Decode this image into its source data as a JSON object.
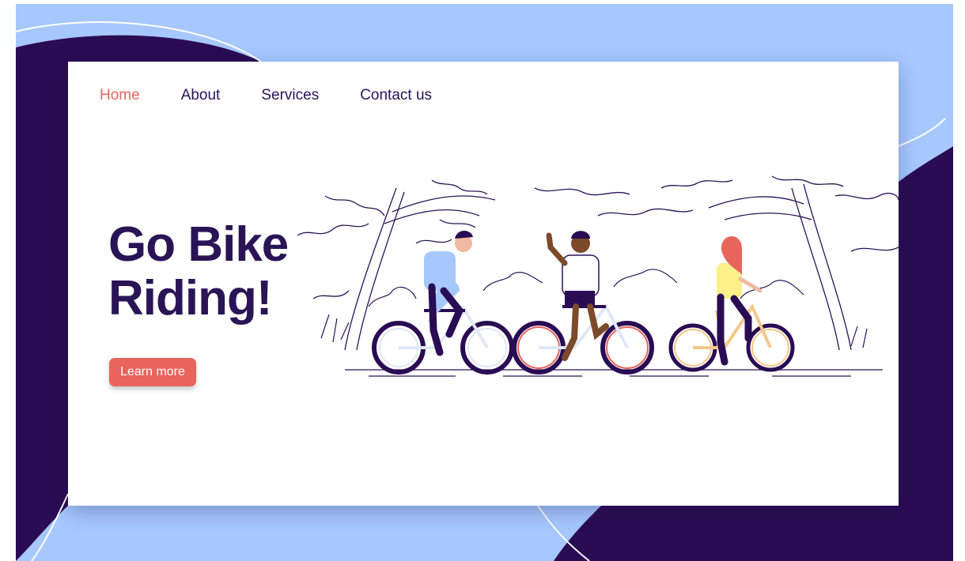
{
  "nav": {
    "items": [
      {
        "label": "Home",
        "active": true
      },
      {
        "label": "About",
        "active": false
      },
      {
        "label": "Services",
        "active": false
      },
      {
        "label": "Contact us",
        "active": false
      }
    ]
  },
  "hero": {
    "title_line1": "Go Bike",
    "title_line2": "Riding!",
    "cta_label": "Learn more"
  },
  "colors": {
    "background_light": "#a6c8ff",
    "background_dark": "#2a0c54",
    "accent": "#e8655d",
    "text": "#2a1456"
  },
  "illustration": "three-cyclists-in-park-illustration"
}
